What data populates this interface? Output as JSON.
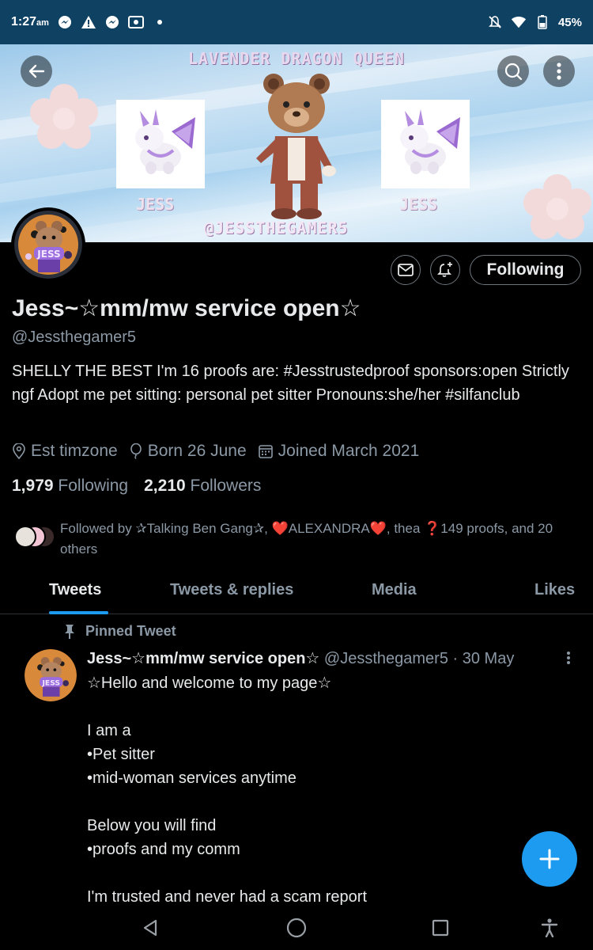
{
  "status_bar": {
    "time": "1:27",
    "ampm": "am",
    "battery": "45%",
    "notification_icons": [
      "messenger-icon",
      "warning-icon",
      "messenger-icon",
      "screenshot-icon",
      "dot-icon"
    ],
    "system_icons": [
      "mute-icon",
      "wifi-icon",
      "battery-icon"
    ]
  },
  "banner": {
    "title": "LAVENDER DRAGON QUEEN",
    "handle": "@JESSTHEGAMER5",
    "left_label": "JESS",
    "right_label": "JESS"
  },
  "profile": {
    "name": "Jess~☆mm/mw service open☆",
    "handle": "@Jessthegamer5",
    "bio": "SHELLY THE BEST I'm 16 proofs are: #Jesstrustedproof sponsors:open Strictly ngf Adopt me pet sitting: personal pet sitter Pronouns:she/her #silfanclub",
    "location": "Est timzone",
    "birthday": "Born 26 June",
    "joined": "Joined March 2021",
    "following_count": "1,979",
    "following_label": "Following",
    "followers_count": "2,210",
    "followers_label": "Followers",
    "followed_by": "Followed by ✰Talking Ben Gang✰, ❤️ALEXANDRA❤️, thea ❓149 proofs, and 20 others",
    "following_button": "Following"
  },
  "tabs": [
    {
      "label": "Tweets",
      "active": true
    },
    {
      "label": "Tweets & replies",
      "active": false
    },
    {
      "label": "Media",
      "active": false
    },
    {
      "label": "Likes",
      "active": false
    }
  ],
  "pinned_tweet": {
    "pinned_label": "Pinned Tweet",
    "author_name": "Jess~☆mm/mw service open☆",
    "author_handle": "@Jessthegamer5",
    "date": "· 30 May",
    "body": "☆Hello and welcome to my page☆\n\nI am a\n•Pet sitter\n•mid-woman services anytime\n\nBelow you will find\n•proofs and my comm\n\nI'm trusted and never had a scam report"
  },
  "colors": {
    "accent": "#1d9bf0",
    "status_bar": "#0f4163",
    "background": "#000000",
    "secondary_text": "#8b98a5"
  }
}
